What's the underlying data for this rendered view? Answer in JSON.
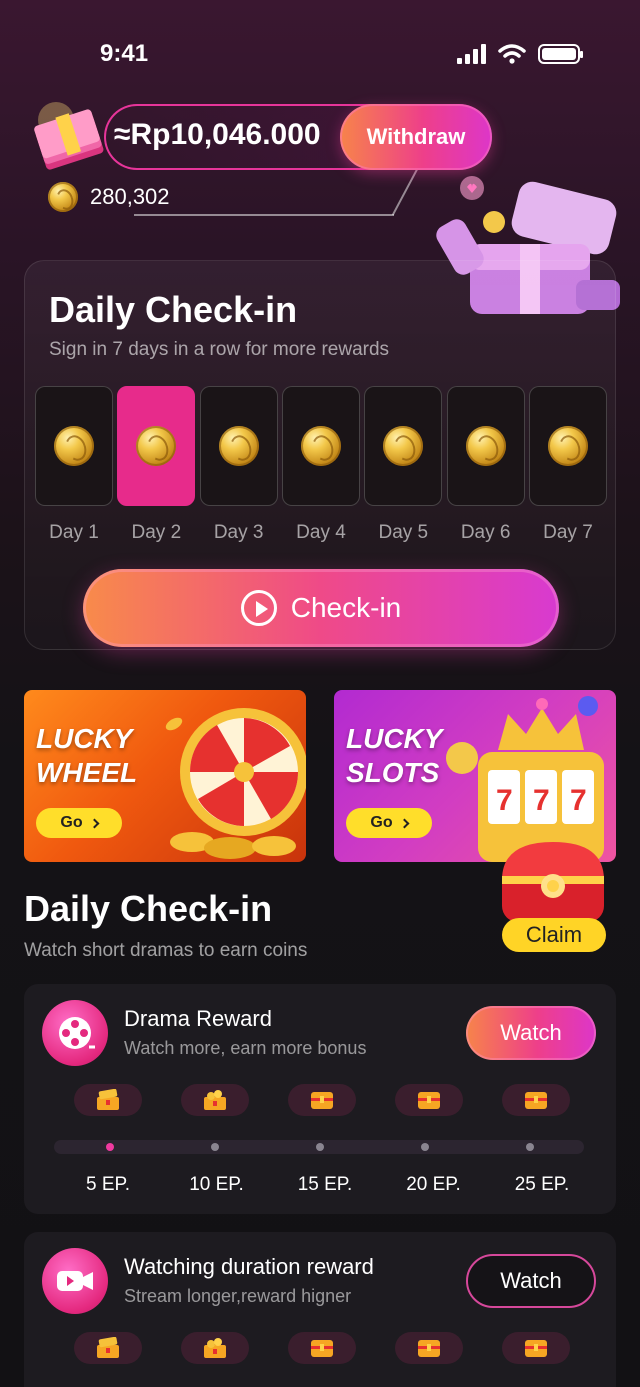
{
  "status_bar": {
    "time": "9:41"
  },
  "balance": {
    "amount": "≈Rp10,046.000",
    "withdraw_label": "Withdraw",
    "coins": "280,302"
  },
  "checkin": {
    "title": "Daily Check-in",
    "subtitle": "Sign in 7 days in a row for more rewards",
    "days": [
      "Day 1",
      "Day 2",
      "Day 3",
      "Day 4",
      "Day 5",
      "Day 6",
      "Day 7"
    ],
    "active_day": 2,
    "button_label": "Check-in"
  },
  "banners": {
    "wheel": {
      "title": "LUCKY\nWHEEL",
      "go_label": "Go"
    },
    "slots": {
      "title": "LUCKY\nSLOTS",
      "go_label": "Go"
    }
  },
  "claim_label": "Claim",
  "section": {
    "title": "Daily Check-in",
    "subtitle": "Watch short dramas to earn coins"
  },
  "rewards": [
    {
      "title": "Drama Reward",
      "subtitle": "Watch more, earn more bonus",
      "button_label": "Watch",
      "milestones": [
        "5 EP.",
        "10 EP.",
        "15 EP.",
        "20 EP.",
        "25 EP."
      ],
      "progress_step": 1
    },
    {
      "title": "Watching duration reward",
      "subtitle": "Stream longer,reward higner",
      "button_label": "Watch"
    }
  ],
  "colors": {
    "accent_pink": "#e72b8b",
    "accent_orange": "#f7844a",
    "accent_purple": "#dd36c9",
    "gold": "#ffd426"
  }
}
